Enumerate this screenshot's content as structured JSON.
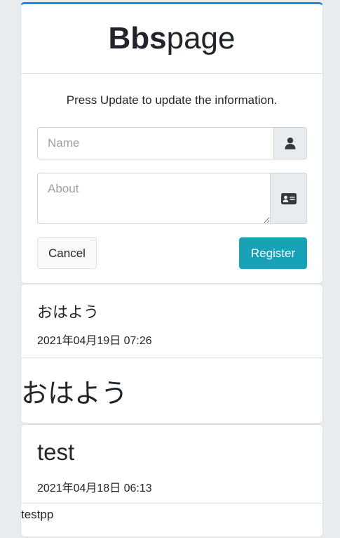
{
  "brand": {
    "strong": "Bbs",
    "light": "page"
  },
  "form": {
    "helper_text": "Press Update to update the information.",
    "name_placeholder": "Name",
    "name_value": "",
    "name_icon": "user-icon",
    "about_placeholder": "About",
    "about_value": "",
    "about_icon": "id-card-icon",
    "cancel_label": "Cancel",
    "register_label": "Register"
  },
  "colors": {
    "accent_top_border": "#1e88e5",
    "register_button": "#17a2b8",
    "page_background": "#e9ecef"
  },
  "posts": [
    {
      "name": "おはよう",
      "date": "2021年04月19日 07:26",
      "body": "おはよう"
    },
    {
      "name": "test",
      "date": "2021年04月18日 06:13",
      "body": "testpp"
    }
  ]
}
